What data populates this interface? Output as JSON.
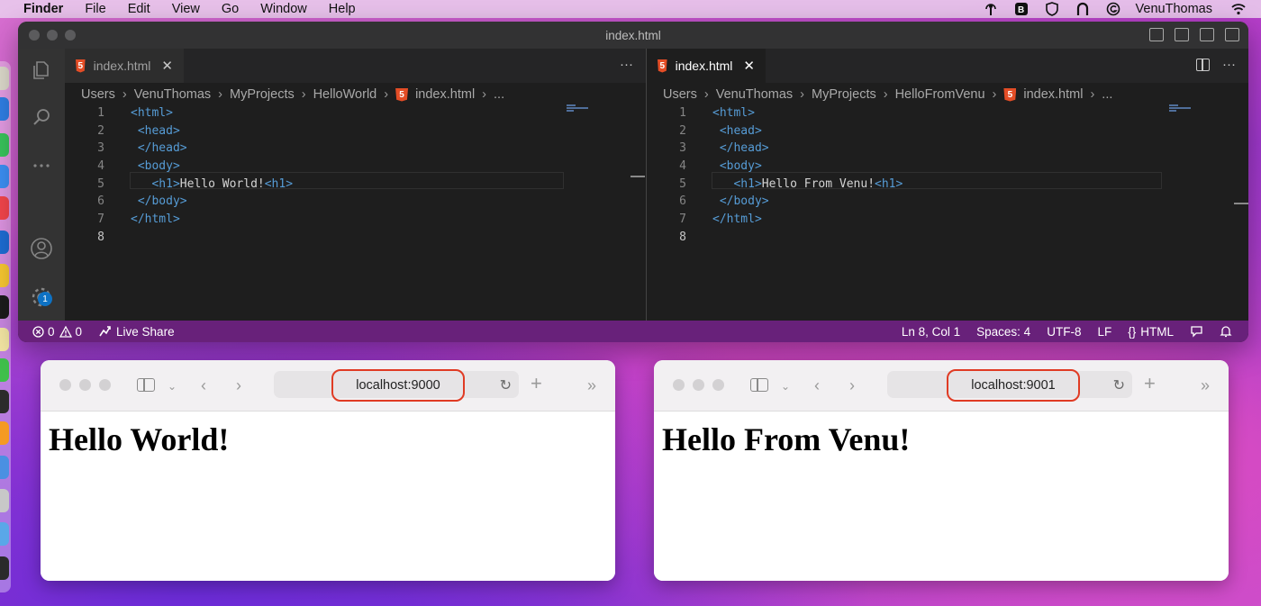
{
  "menubar": {
    "app": "Finder",
    "items": [
      "File",
      "Edit",
      "View",
      "Go",
      "Window",
      "Help"
    ],
    "user": "VenuThomas"
  },
  "vscode": {
    "title": "index.html",
    "left": {
      "tab": "index.html",
      "breadcrumb": [
        "Users",
        "VenuThomas",
        "MyProjects",
        "HelloWorld",
        "index.html",
        "..."
      ],
      "lines": [
        {
          "n": "1",
          "pre": "",
          "open": "<html>",
          "text": "",
          "close": ""
        },
        {
          "n": "2",
          "pre": " ",
          "open": "<head>",
          "text": "",
          "close": ""
        },
        {
          "n": "3",
          "pre": " ",
          "open": "</head>",
          "text": "",
          "close": ""
        },
        {
          "n": "4",
          "pre": " ",
          "open": "<body>",
          "text": "",
          "close": ""
        },
        {
          "n": "5",
          "pre": "   ",
          "open": "<h1>",
          "text": "Hello World!",
          "close": "<h1>"
        },
        {
          "n": "6",
          "pre": " ",
          "open": "</body>",
          "text": "",
          "close": ""
        },
        {
          "n": "7",
          "pre": "",
          "open": "</html>",
          "text": "",
          "close": ""
        },
        {
          "n": "8",
          "pre": "",
          "open": "",
          "text": "",
          "close": ""
        }
      ]
    },
    "right": {
      "tab": "index.html",
      "breadcrumb": [
        "Users",
        "VenuThomas",
        "MyProjects",
        "HelloFromVenu",
        "index.html",
        "..."
      ],
      "lines": [
        {
          "n": "1",
          "pre": "",
          "open": "<html>",
          "text": "",
          "close": ""
        },
        {
          "n": "2",
          "pre": " ",
          "open": "<head>",
          "text": "",
          "close": ""
        },
        {
          "n": "3",
          "pre": " ",
          "open": "</head>",
          "text": "",
          "close": ""
        },
        {
          "n": "4",
          "pre": " ",
          "open": "<body>",
          "text": "",
          "close": ""
        },
        {
          "n": "5",
          "pre": "   ",
          "open": "<h1>",
          "text": "Hello From Venu!",
          "close": "<h1>"
        },
        {
          "n": "6",
          "pre": " ",
          "open": "</body>",
          "text": "",
          "close": ""
        },
        {
          "n": "7",
          "pre": "",
          "open": "</html>",
          "text": "",
          "close": ""
        },
        {
          "n": "8",
          "pre": "",
          "open": "",
          "text": "",
          "close": ""
        }
      ]
    },
    "badge_count": "1",
    "status": {
      "errors": "0",
      "warnings": "0",
      "live_share": "Live Share",
      "position": "Ln 8, Col 1",
      "spaces": "Spaces: 4",
      "encoding": "UTF-8",
      "eol": "LF",
      "language": "HTML"
    },
    "colors": {
      "statusbar": "#68217a",
      "tag": "#569cd6"
    }
  },
  "browsers": [
    {
      "url": "localhost:9000",
      "heading": "Hello World!"
    },
    {
      "url": "localhost:9001",
      "heading": "Hello From Venu!"
    }
  ]
}
